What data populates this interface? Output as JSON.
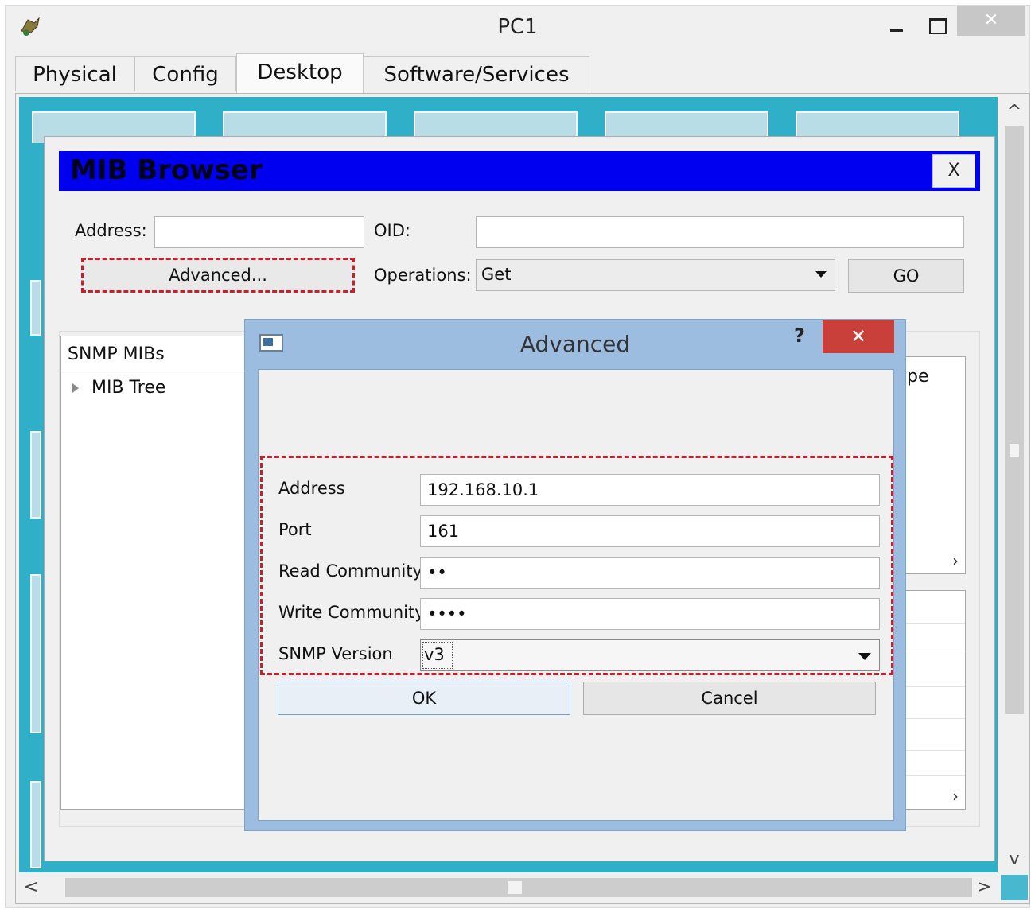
{
  "window": {
    "title": "PC1",
    "close_glyph": "✕"
  },
  "tabs": [
    "Physical",
    "Config",
    "Desktop",
    "Software/Services"
  ],
  "active_tab": "Desktop",
  "mib_browser": {
    "title": "MIB Browser",
    "close_label": "X",
    "address_label": "Address:",
    "address_value": "",
    "oid_label": "OID:",
    "oid_value": "",
    "advanced_button": "Advanced...",
    "operations_label": "Operations:",
    "operations_value": "Get",
    "go_button": "GO",
    "tree_header": "SNMP MIBs",
    "tree_item": "MIB Tree",
    "result_column": "Type",
    "scroll_right": "›"
  },
  "advanced": {
    "title": "Advanced",
    "help": "?",
    "close": "✕",
    "fields": {
      "address": {
        "label": "Address",
        "value": "192.168.10.1"
      },
      "port": {
        "label": "Port",
        "value": "161"
      },
      "read_community": {
        "label": "Read Community",
        "value": "••"
      },
      "write_community": {
        "label": "Write Community",
        "value": "••••"
      },
      "snmp_version": {
        "label": "SNMP Version",
        "value": "v3"
      }
    },
    "ok_button": "OK",
    "cancel_button": "Cancel"
  },
  "scrollbar": {
    "up": "^",
    "down": "v",
    "left": "<",
    "right": ">"
  },
  "colors": {
    "desktop_bg": "#30b0c8",
    "mib_title_bg": "#0000f0",
    "highlight_dash": "#c8202a",
    "dialog_frame": "#9cbde0",
    "dialog_close": "#c9403b"
  }
}
